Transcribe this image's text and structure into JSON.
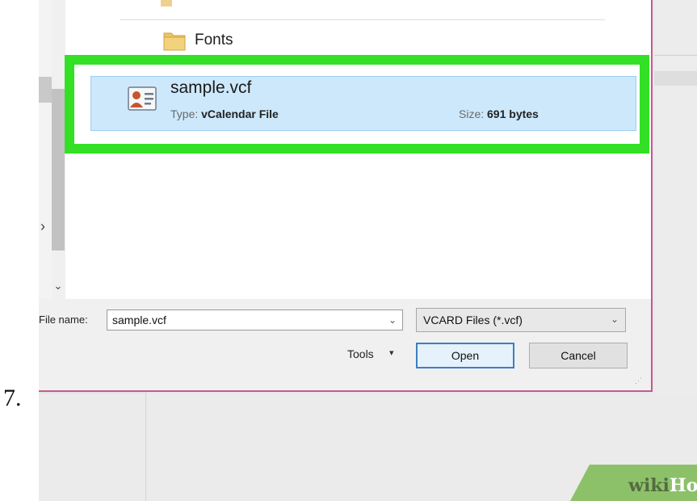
{
  "step": {
    "number": "7."
  },
  "navigation": {
    "scroll_down_glyph": "⌄"
  },
  "folders": [
    {
      "label": "Fonts",
      "icon": "folder-icon"
    }
  ],
  "selected_file": {
    "name": "sample.vcf",
    "icon": "vcard-contact-icon",
    "type_label": "Type:",
    "type_value": "vCalendar File",
    "size_label": "Size:",
    "size_value": "691 bytes"
  },
  "file_name_field": {
    "label": "File name:",
    "value": "sample.vcf",
    "dropdown_glyph": "⌄"
  },
  "file_type_filter": {
    "selected": "VCARD Files (*.vcf)",
    "chevron": "⌄"
  },
  "buttons": {
    "tools": "Tools",
    "tools_arrow": "▾",
    "open": "Open",
    "cancel": "Cancel"
  },
  "watermark": {
    "part1": "wiki",
    "part2": "How"
  },
  "colors": {
    "highlight": "#33e025",
    "selection": "#cde8fb",
    "dialog_border": "#c45a8e",
    "open_border": "#3c7fc1"
  }
}
